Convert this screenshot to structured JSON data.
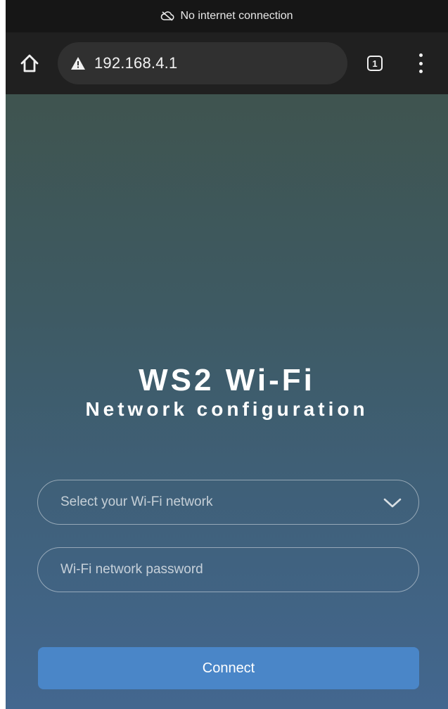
{
  "status_bar": {
    "icon": "cloud-off-icon",
    "text": "No internet connection"
  },
  "browser": {
    "home_icon": "home-icon",
    "security_icon": "warning-icon",
    "url": "192.168.4.1",
    "tab_count": "1",
    "menu_icon": "more-vertical-icon"
  },
  "page": {
    "title": "WS2 Wi-Fi",
    "subtitle": "Network configuration",
    "network_select": {
      "placeholder": "Select your Wi-Fi network",
      "icon": "chevron-down-icon"
    },
    "password_field": {
      "placeholder": "Wi-Fi network password"
    },
    "connect_label": "Connect"
  },
  "colors": {
    "status_bar_bg": "#161616",
    "browser_bar_bg": "#202020",
    "url_pill_bg": "#303030",
    "gradient_top": "#3f544f",
    "gradient_bottom": "#43678f",
    "connect_button": "#4a86c8"
  }
}
